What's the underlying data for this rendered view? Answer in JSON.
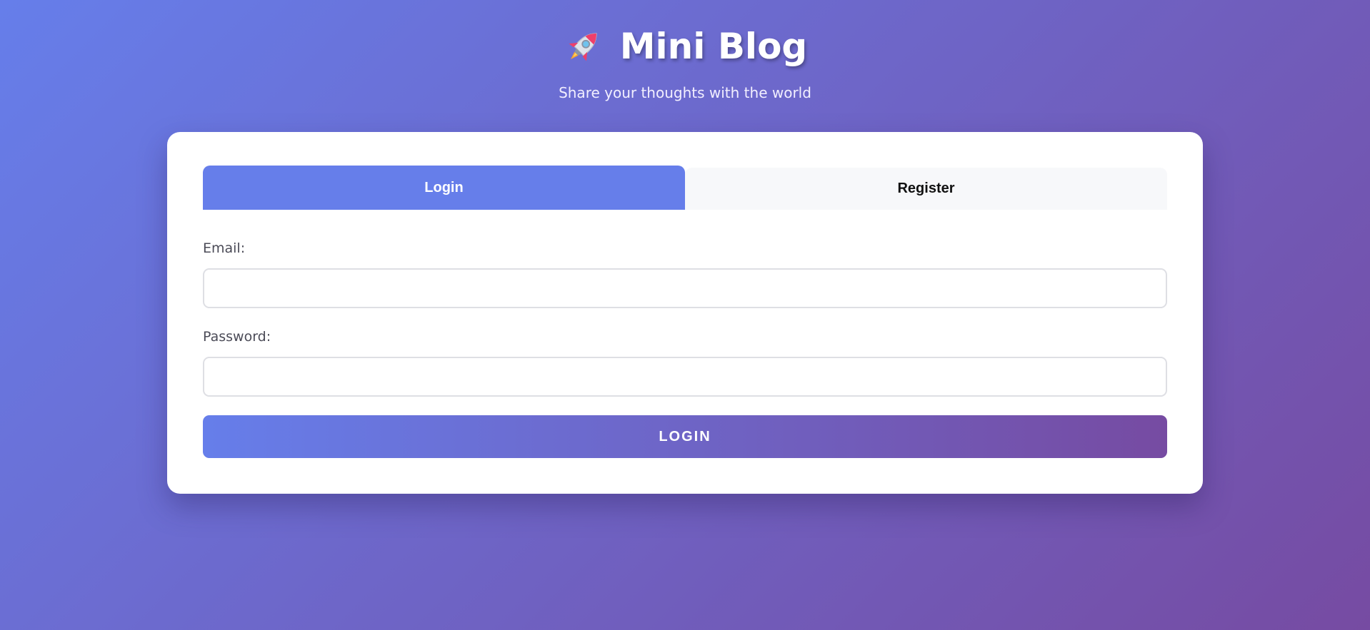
{
  "header": {
    "logo_icon": "rocket-icon",
    "title": "Mini Blog",
    "subtitle": "Share your thoughts with the world"
  },
  "tabs": [
    {
      "label": "Login",
      "active": true
    },
    {
      "label": "Register",
      "active": false
    }
  ],
  "form": {
    "email_label": "Email:",
    "email_value": "",
    "password_label": "Password:",
    "password_value": "",
    "submit_label": "LOGIN"
  },
  "colors": {
    "gradient_start": "#667eea",
    "gradient_end": "#764ba2",
    "active_tab": "#667eea",
    "inactive_tab": "#f7f8fa",
    "card": "#ffffff"
  }
}
